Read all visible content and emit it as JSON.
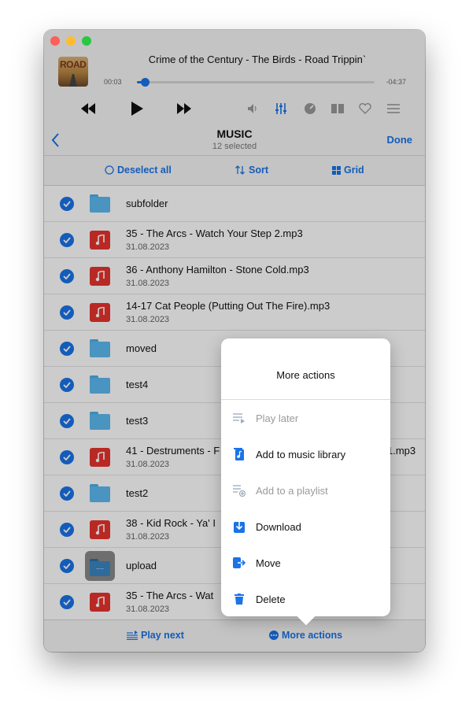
{
  "player": {
    "album_art_text": "ROAD",
    "track_title": "Crime of the Century - The Birds - Road Trippin`",
    "time_elapsed": "00:03",
    "time_remaining": "-04:37",
    "progress": 0.02
  },
  "nav": {
    "title": "MUSIC",
    "subtitle": "12 selected",
    "done_label": "Done"
  },
  "toolbar": {
    "deselect_label": "Deselect all",
    "sort_label": "Sort",
    "grid_label": "Grid"
  },
  "rows": [
    {
      "type": "folder",
      "name": "subfolder",
      "date": ""
    },
    {
      "type": "music",
      "name": "35 - The Arcs - Watch Your Step 2.mp3",
      "date": "31.08.2023"
    },
    {
      "type": "music",
      "name": "36 - Anthony Hamilton - Stone Cold.mp3",
      "date": "31.08.2023"
    },
    {
      "type": "music",
      "name": "14-17 Cat People (Putting Out The Fire).mp3",
      "date": "31.08.2023"
    },
    {
      "type": "folder",
      "name": "moved",
      "date": ""
    },
    {
      "type": "folder",
      "name": "test4",
      "date": ""
    },
    {
      "type": "folder",
      "name": "test3",
      "date": ""
    },
    {
      "type": "music",
      "name": "41 - Destruments - F",
      "name_tail": "1.mp3",
      "date": "31.08.2023"
    },
    {
      "type": "folder",
      "name": "test2",
      "date": ""
    },
    {
      "type": "music",
      "name": "38 - Kid Rock - Ya' I",
      "date": "31.08.2023"
    },
    {
      "type": "upload",
      "name": "upload",
      "date": "",
      "icon_text": "...."
    },
    {
      "type": "music",
      "name": "35 - The Arcs - Wat",
      "date": "31.08.2023"
    }
  ],
  "popover": {
    "title": "More actions",
    "items": [
      {
        "label": "Play later",
        "icon": "play-later-icon",
        "enabled": false
      },
      {
        "label": "Add to music library",
        "icon": "music-library-icon",
        "enabled": true
      },
      {
        "label": "Add to a playlist",
        "icon": "add-playlist-icon",
        "enabled": false
      },
      {
        "label": "Download",
        "icon": "download-icon",
        "enabled": true
      },
      {
        "label": "Move",
        "icon": "move-icon",
        "enabled": true
      },
      {
        "label": "Delete",
        "icon": "trash-icon",
        "enabled": true
      }
    ]
  },
  "bottombar": {
    "play_next_label": "Play next",
    "more_actions_label": "More actions"
  },
  "colors": {
    "accent": "#1a73e8",
    "folder": "#5cbaf0",
    "music_file": "#e8342e"
  }
}
